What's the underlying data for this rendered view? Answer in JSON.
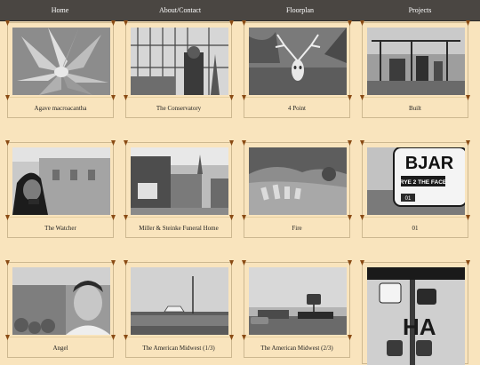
{
  "nav": {
    "items": [
      "Home",
      "About/Contact",
      "Floorplan",
      "Projects"
    ]
  },
  "gallery": {
    "items": [
      {
        "caption": "Agave macroacantha"
      },
      {
        "caption": "The Conservatory"
      },
      {
        "caption": "4 Point"
      },
      {
        "caption": "Built"
      },
      {
        "caption": "The Watcher"
      },
      {
        "caption": "Miller & Steinke Funeral Home"
      },
      {
        "caption": "Fire"
      },
      {
        "caption": "01"
      },
      {
        "caption": "Angel"
      },
      {
        "caption": "The American Midwest (1/3)"
      },
      {
        "caption": "The American Midwest (2/3)"
      },
      {
        "caption": ""
      }
    ],
    "sign_text": {
      "bjar": "BJAR",
      "face": "RYE 2 THE FACE",
      "number": "01",
      "ha": "HA"
    }
  },
  "colors": {
    "background": "#f9e4bd",
    "navbar": "#4a4642",
    "pin": "#8a4b14"
  }
}
